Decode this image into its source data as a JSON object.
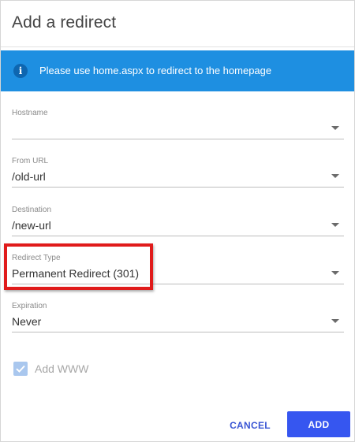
{
  "dialog": {
    "title": "Add a redirect"
  },
  "info_banner": {
    "text": "Please use home.aspx to redirect to the homepage",
    "icon": "info-icon",
    "background": "#1e8fe1"
  },
  "fields": {
    "hostname": {
      "label": "Hostname",
      "value": ""
    },
    "from_url": {
      "label": "From URL",
      "value": "/old-url"
    },
    "destination": {
      "label": "Destination",
      "value": "/new-url"
    },
    "redirect_type": {
      "label": "Redirect Type",
      "value": "Permanent Redirect (301)"
    },
    "expiration": {
      "label": "Expiration",
      "value": "Never"
    }
  },
  "add_www": {
    "label": "Add WWW",
    "checked": true,
    "disabled": true
  },
  "actions": {
    "cancel_label": "CANCEL",
    "add_label": "ADD",
    "accent": "#3656f0"
  },
  "annotation": {
    "highlight_color": "#e01b1b"
  }
}
